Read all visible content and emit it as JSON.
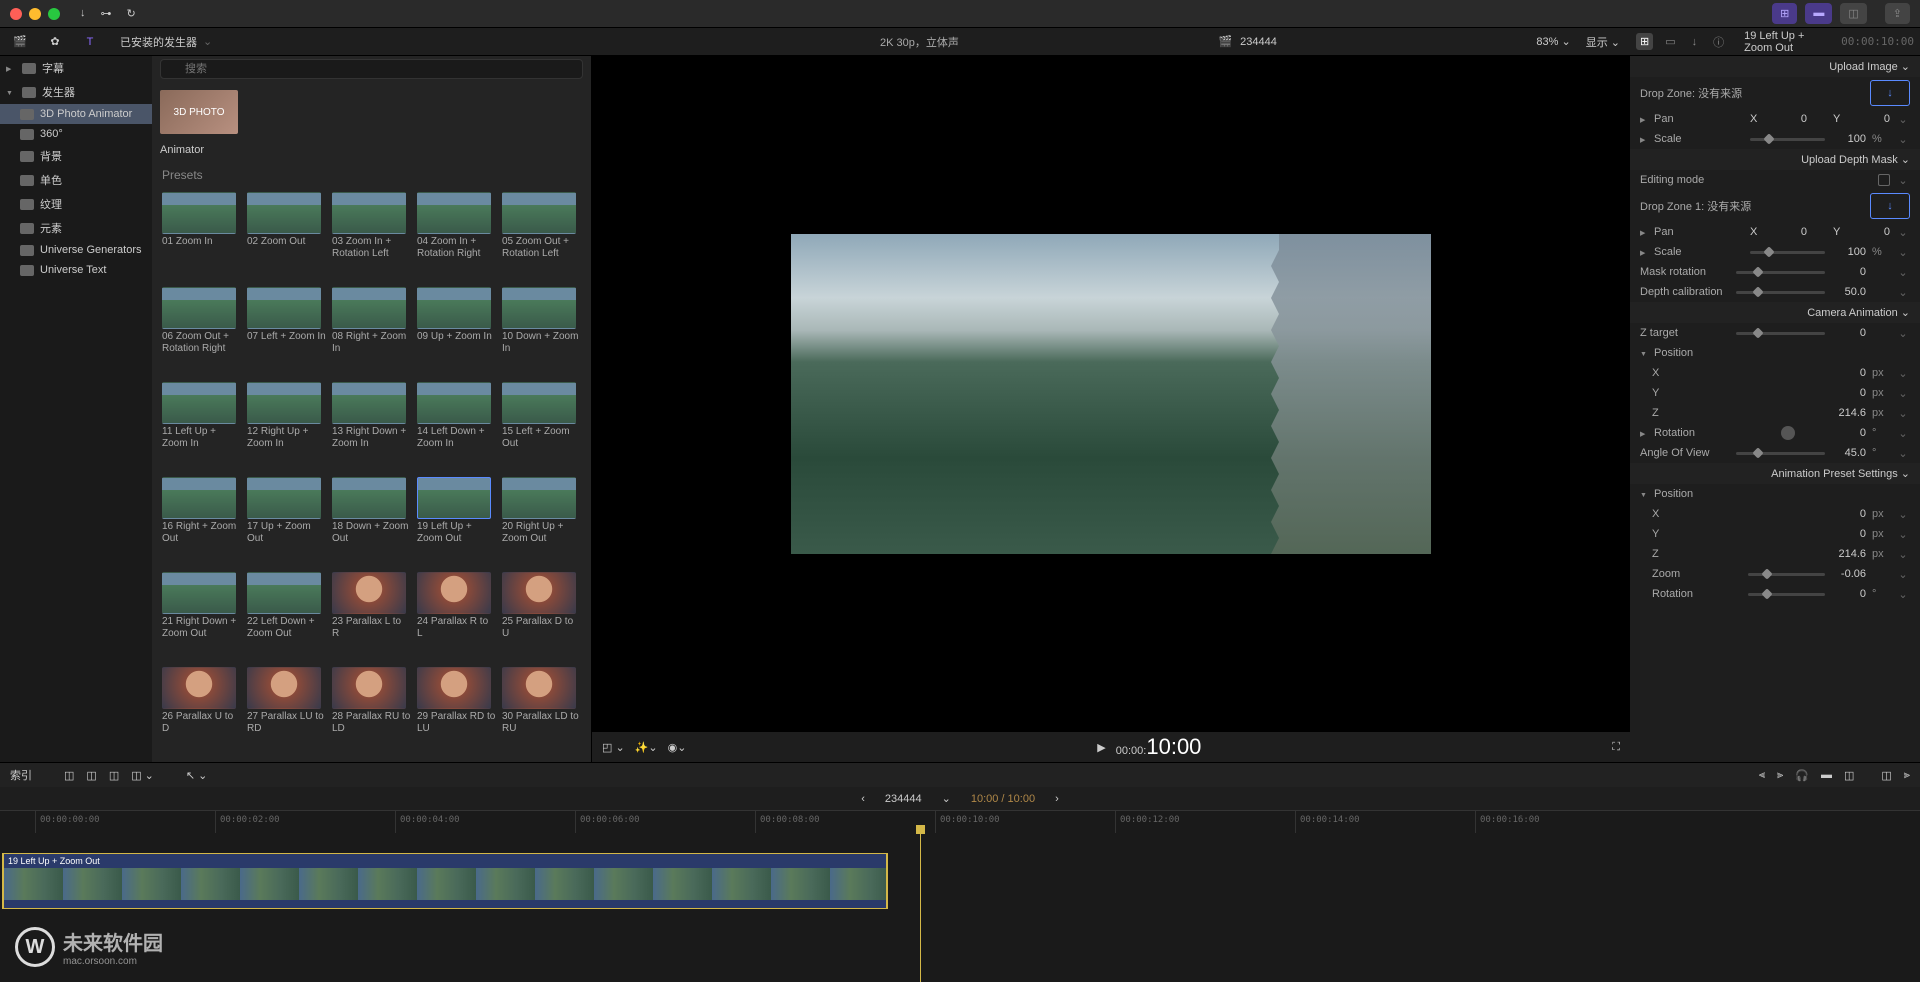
{
  "toolbar": {
    "installed_label": "已安装的发生器",
    "viewer_info": "2K 30p，立体声",
    "clip_name": "234444",
    "zoom": "83%",
    "display_label": "显示"
  },
  "search": {
    "placeholder": "搜索"
  },
  "sidebar": {
    "items": [
      {
        "label": "字幕",
        "root": true,
        "open": false
      },
      {
        "label": "发生器",
        "root": true,
        "open": true
      },
      {
        "label": "3D Photo Animator",
        "selected": true
      },
      {
        "label": "360°"
      },
      {
        "label": "背景"
      },
      {
        "label": "单色"
      },
      {
        "label": "纹理"
      },
      {
        "label": "元素"
      },
      {
        "label": "Universe Generators"
      },
      {
        "label": "Universe Text"
      }
    ]
  },
  "animator": {
    "thumb_label": "3D PHOTO",
    "name": "Animator"
  },
  "presets_header": "Presets",
  "presets": [
    {
      "label": "01 Zoom In"
    },
    {
      "label": "02 Zoom Out"
    },
    {
      "label": "03 Zoom In + Rotation Left"
    },
    {
      "label": "04 Zoom In + Rotation Right"
    },
    {
      "label": "05 Zoom Out + Rotation Left"
    },
    {
      "label": "06 Zoom Out + Rotation Right"
    },
    {
      "label": "07 Left + Zoom In"
    },
    {
      "label": "08 Right + Zoom In"
    },
    {
      "label": "09 Up + Zoom In"
    },
    {
      "label": "10 Down + Zoom In"
    },
    {
      "label": "11 Left Up + Zoom In"
    },
    {
      "label": "12 Right Up + Zoom In"
    },
    {
      "label": "13 Right Down + Zoom In"
    },
    {
      "label": "14 Left Down + Zoom In"
    },
    {
      "label": "15 Left + Zoom Out"
    },
    {
      "label": "16 Right + Zoom Out"
    },
    {
      "label": "17 Up + Zoom Out"
    },
    {
      "label": "18 Down + Zoom Out"
    },
    {
      "label": "19 Left Up + Zoom Out",
      "selected": true
    },
    {
      "label": "20 Right Up + Zoom Out"
    },
    {
      "label": "21 Right Down + Zoom Out"
    },
    {
      "label": "22 Left Down + Zoom Out"
    },
    {
      "label": "23 Parallax L to R",
      "face": true
    },
    {
      "label": "24 Parallax R to L",
      "face": true
    },
    {
      "label": "25 Parallax D to U",
      "face": true
    },
    {
      "label": "26 Parallax U to D",
      "face": true
    },
    {
      "label": "27 Parallax LU to RD",
      "face": true
    },
    {
      "label": "28 Parallax RU to LD",
      "face": true
    },
    {
      "label": "29 Parallax RD to LU",
      "face": true
    },
    {
      "label": "30 Parallax LD to RU",
      "face": true
    }
  ],
  "viewer": {
    "timecode_prefix": "00:00:",
    "timecode_main": "10:00"
  },
  "inspector": {
    "title": "19 Left Up + Zoom Out",
    "tc": "00:00:10:00",
    "upload_image": "Upload Image",
    "dropzone": "Drop Zone: 没有来源",
    "pan": "Pan",
    "x": "X",
    "y": "Y",
    "val_0": "0",
    "scale": "Scale",
    "scale_val": "100",
    "pct": "%",
    "upload_depth": "Upload Depth Mask",
    "editing_mode": "Editing mode",
    "dropzone1": "Drop Zone 1: 没有来源",
    "mask_rotation": "Mask rotation",
    "mask_rot_val": "0",
    "depth_cal": "Depth calibration",
    "depth_val": "50.0",
    "camera_anim": "Camera Animation",
    "z_target": "Z target",
    "z_target_val": "0",
    "position": "Position",
    "pos_x_val": "0",
    "pos_y_val": "0",
    "pos_z_val": "214.6",
    "px": "px",
    "rotation": "Rotation",
    "rot_val": "0",
    "deg": "°",
    "angle": "Angle Of View",
    "angle_val": "45.0",
    "anim_preset": "Animation Preset Settings",
    "zoom_label": "Zoom",
    "zoom_val": "-0.06"
  },
  "timeline": {
    "index_label": "索引",
    "project": "234444",
    "duration": "10:00 / 10:00",
    "ticks": [
      "00:00:00:00",
      "00:00:02:00",
      "00:00:04:00",
      "00:00:06:00",
      "00:00:08:00",
      "00:00:10:00",
      "00:00:12:00",
      "00:00:14:00",
      "00:00:16:00"
    ],
    "clip_label": "19 Left Up + Zoom Out"
  },
  "watermark": {
    "title": "未来软件园",
    "url": "mac.orsoon.com"
  }
}
